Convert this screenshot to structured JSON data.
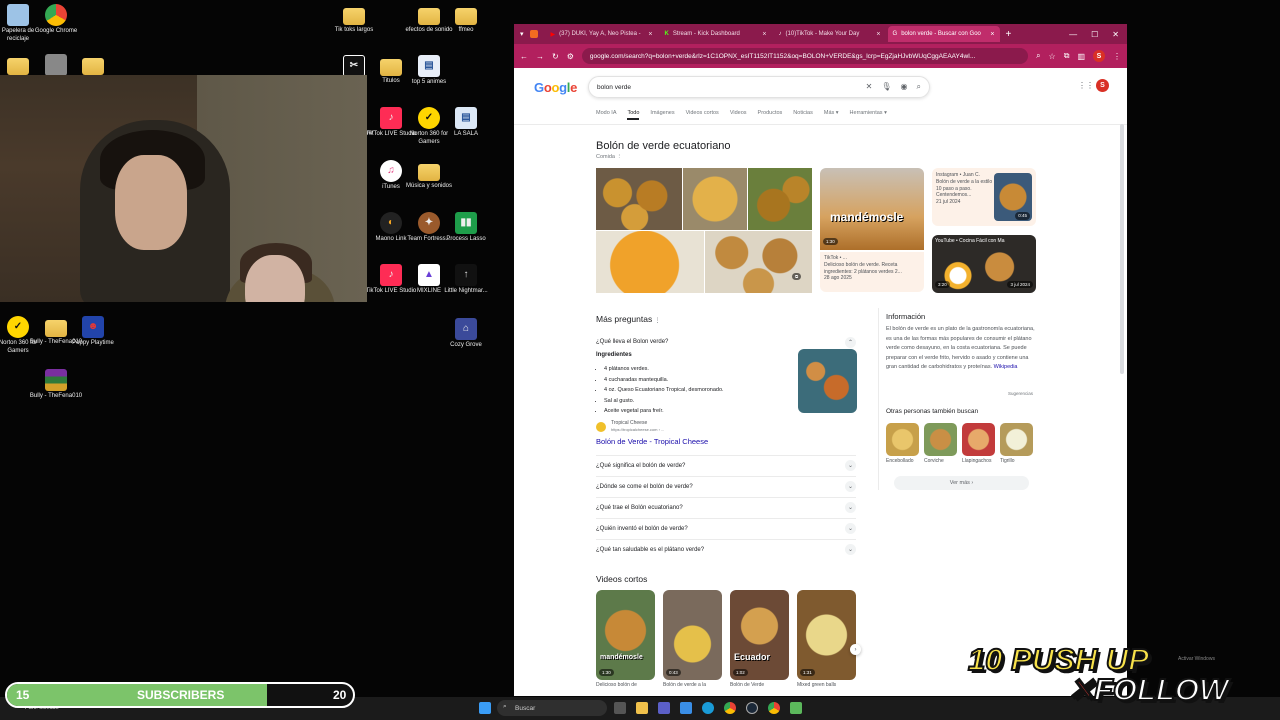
{
  "desktop": {
    "icons": [
      {
        "label": "Papelera de reciclaje",
        "icon": "recycle-bin-icon"
      },
      {
        "label": "Google Chrome",
        "icon": "chrome-icon"
      },
      {
        "label": "Tik toks largos",
        "icon": "folder-icon"
      },
      {
        "label": "efectos de sonido",
        "icon": "folder-icon"
      },
      {
        "label": "ffmeo",
        "icon": "folder-icon"
      },
      {
        "label": "Titulos",
        "icon": "folder-icon"
      },
      {
        "label": "top 5 animes",
        "icon": "document-icon"
      },
      {
        "label": "TikTok LIVE Studio",
        "icon": "tiktok-icon"
      },
      {
        "label": "Norton 360 for Gamers",
        "icon": "norton-icon"
      },
      {
        "label": "LA SALA",
        "icon": "document-icon"
      },
      {
        "label": "iTunes",
        "icon": "itunes-icon"
      },
      {
        "label": "Música y sonidos",
        "icon": "folder-icon"
      },
      {
        "label": "Maono Link",
        "icon": "maono-icon"
      },
      {
        "label": "Team Fortress...",
        "icon": "tf2-icon"
      },
      {
        "label": "Process Lasso",
        "icon": "chart-icon"
      },
      {
        "label": "TikTok LIVE Studio",
        "icon": "tiktok-icon"
      },
      {
        "label": "MIXLINE",
        "icon": "mixline-icon"
      },
      {
        "label": "Little Nightmar...",
        "icon": "game-icon"
      },
      {
        "label": "Cozy Grove",
        "icon": "game-icon"
      },
      {
        "label": "Norton 360 for Gamers",
        "icon": "norton-icon"
      },
      {
        "label": "Bully - TheFena010",
        "icon": "folder-icon"
      },
      {
        "label": "Poppy Playtime",
        "icon": "game-icon"
      },
      {
        "label": "Bully - TheFena010",
        "icon": "winrar-icon"
      }
    ],
    "stray": {
      "wer": "wer"
    }
  },
  "browser": {
    "tabs": [
      {
        "label": "(37) DUKI, Yay A, Neo Pistea -",
        "active": false
      },
      {
        "label": "Stream - Kick Dashboard",
        "active": false
      },
      {
        "label": "(10)TikTok - Make Your Day",
        "active": false
      },
      {
        "label": "bolon verde - Buscar con Goo",
        "active": true
      }
    ],
    "url": "google.com/search?q=bolon+verde&sca_esv=...&biw=1280&bih=...",
    "url_display": "google.com/search?q=bolon+verde&rlz=1C1OPNX_esIT1152IT1152&oq=BOLON+VERDE&gs_lcrp=EgZjaHJvbWUqCggAEAAY4wI...",
    "avatar": "S"
  },
  "google": {
    "logo": "Google",
    "query": "bolon verde",
    "tools": [
      "Modo IA",
      "Todo",
      "Imágenes",
      "Videos cortos",
      "Videos",
      "Productos",
      "Noticias",
      "Más ▾",
      "Herramientas ▾"
    ],
    "result_title": "Bolón de verde ecuatoriano",
    "result_sub": "Comida",
    "media": {
      "tiktok_source": "TikTok • ...",
      "tiktok_caption": "Delicioso bolón de verde. Receta ingredientes: 2 plátanos verdes 2...",
      "tiktok_date": "28 ago 2025",
      "tiktok_dur": "1:30",
      "mandemosle": "mandémosle",
      "instagram_source": "Instagram • Juan C.",
      "instagram_caption": "Bolón de verde a la estilo 10 paso a paso. Centendemos...",
      "instagram_date": "21 jul 2024",
      "instagram_dur": "0:45",
      "youtube_source": "YouTube • Cocina Fácil con Ma",
      "youtube_dur": "3:20",
      "youtube_date": "3 jul 2024"
    },
    "paa_title": "Más preguntas",
    "paa_open": "¿Qué lleva el Bolon verde?",
    "ingredients_title": "Ingredientes",
    "ingredients": [
      "4 plátanos verdes.",
      "4 cucharadas mantequilla.",
      "4 oz. Queso Ecuatoriano Tropical, desmoronado.",
      "Sal al gusto.",
      "Aceite vegetal para freír."
    ],
    "source_name": "Tropical Cheese",
    "source_url": "https://tropicalcheese.com › ...",
    "source_link": "Bolón de Verde - Tropical Cheese",
    "paa_more": [
      "¿Qué significa el bolón de verde?",
      "¿Dónde se come el bolón de verde?",
      "¿Qué trae el Bolón ecuatoriano?",
      "¿Quién inventó el bolón de verde?",
      "¿Qué tan saludable es el plátano verde?"
    ],
    "info_title": "Información",
    "info_text": "El bolón de verde es un plato de la gastronomía ecuatoriana, es una de las formas más populares de consumir el plátano verde como desayuno, en la costa ecuatoriana. Se puede preparar con el verde frito, hervido o asado y contiene una gran cantidad de carbohidratos y proteínas.",
    "info_link": "Wikipedia",
    "feedback": "Sugerencias",
    "others_title": "Otras personas también buscan",
    "others": [
      "Encebollado",
      "Corviche",
      "Llapingachos",
      "Tigrillo"
    ],
    "ver_mas": "Ver más ›",
    "short_videos_title": "Videos cortos",
    "short_videos": [
      {
        "caption": "Delicioso bolón de",
        "dur": "1:30",
        "overlay": "mandémosle"
      },
      {
        "caption": "Bolón de verde a la",
        "dur": "0:43",
        "overlay": ""
      },
      {
        "caption": "Bolón de Verde",
        "dur": "1:02",
        "overlay": "Ecuador"
      },
      {
        "caption": "Mixed green balls",
        "dur": "1:31",
        "overlay": ""
      }
    ]
  },
  "taskbar": {
    "search_placeholder": "Buscar",
    "weather": "Parc. soleado"
  },
  "overlay": {
    "subs_current": "15",
    "subs_label": "SUBSCRIBERS",
    "subs_goal": "20",
    "subs_progress": 0.75,
    "promo_line1": "10 PUSH UP",
    "promo_x": "✕",
    "promo_line2": "FOLLOW",
    "activate_windows": "Activar Windows"
  },
  "colors": {
    "browser_frame": "#8b1a4c",
    "browser_addr": "#b2205e",
    "sub_fill": "#7cc46a",
    "promo_yellow": "#f8e24a",
    "google_link": "#1a0dab"
  }
}
